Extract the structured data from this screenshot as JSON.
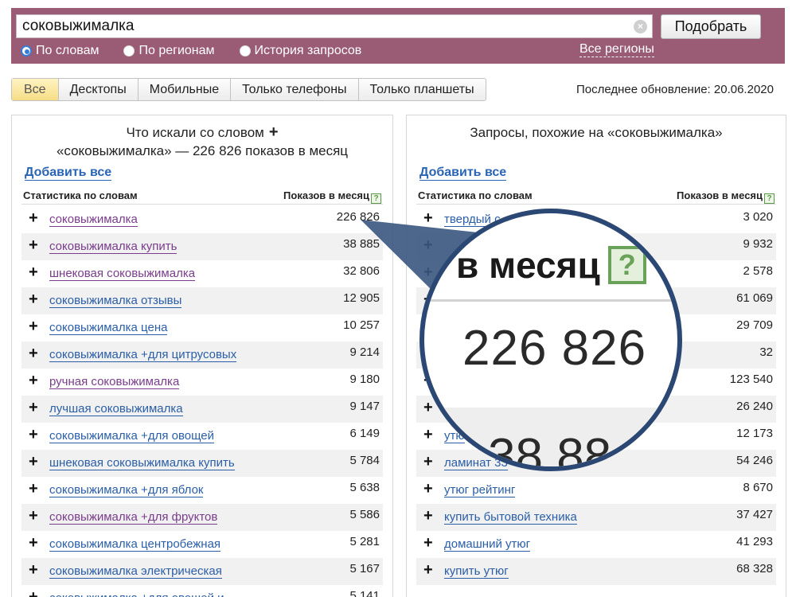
{
  "search": {
    "query": "соковыжималка",
    "clear_label": "×",
    "submit_label": "Подобрать",
    "modes": [
      "По словам",
      "По регионам",
      "История запросов"
    ],
    "selected_mode": "По словам",
    "regions_label": "Все регионы"
  },
  "tabs": [
    "Все",
    "Десктопы",
    "Мобильные",
    "Только телефоны",
    "Только планшеты"
  ],
  "active_tab": "Все",
  "last_update": "Последнее обновление: 20.06.2020",
  "left_panel": {
    "title_line1": "Что искали со словом",
    "title_plus": "+",
    "title_line2": "«соковыжималка» — 226 826 показов в месяц",
    "add_all": "Добавить все",
    "col_phrase": "Статистика по словам",
    "col_count": "Показов в месяц",
    "help_icon": "?",
    "rows": [
      {
        "phrase": "соковыжималка",
        "count": "226 826",
        "visited": true
      },
      {
        "phrase": "соковыжималка купить",
        "count": "38 885",
        "visited": true
      },
      {
        "phrase": "шнековая соковыжималка",
        "count": "32 806",
        "visited": true
      },
      {
        "phrase": "соковыжималка отзывы",
        "count": "12 905",
        "visited": false
      },
      {
        "phrase": "соковыжималка цена",
        "count": "10 257",
        "visited": false
      },
      {
        "phrase": "соковыжималка +для цитрусовых",
        "count": "9 214",
        "visited": false
      },
      {
        "phrase": "ручная соковыжималка",
        "count": "9 180",
        "visited": true
      },
      {
        "phrase": "лучшая соковыжималка",
        "count": "9 147",
        "visited": false
      },
      {
        "phrase": "соковыжималка +для овощей",
        "count": "6 149",
        "visited": false
      },
      {
        "phrase": "шнековая соковыжималка купить",
        "count": "5 784",
        "visited": false
      },
      {
        "phrase": "соковыжималка +для яблок",
        "count": "5 638",
        "visited": false
      },
      {
        "phrase": "соковыжималка +для фруктов",
        "count": "5 586",
        "visited": true
      },
      {
        "phrase": "соковыжималка центробежная",
        "count": "5 281",
        "visited": false
      },
      {
        "phrase": "соковыжималка электрическая",
        "count": "5 167",
        "visited": false
      },
      {
        "phrase": "соковыжималка +для овощей и",
        "count": "5 141",
        "visited": false
      }
    ]
  },
  "right_panel": {
    "title": "Запросы, похожие на «соковыжималка»",
    "add_all": "Добавить все",
    "col_phrase": "Статистика по словам",
    "col_count": "Показов в месяц",
    "help_icon": "?",
    "rows": [
      {
        "phrase": "твердый с",
        "count": "3 020"
      },
      {
        "phrase": "",
        "count": "9 932"
      },
      {
        "phrase": "",
        "count": "2 578"
      },
      {
        "phrase": "",
        "count": "61 069"
      },
      {
        "phrase": "",
        "count": "29 709"
      },
      {
        "phrase": "",
        "count": "32"
      },
      {
        "phrase": "",
        "count": "123 540"
      },
      {
        "phrase": "",
        "count": "26 240"
      },
      {
        "phrase": "утю",
        "count": "12 173"
      },
      {
        "phrase": "ламинат 33",
        "count": "54 246"
      },
      {
        "phrase": "утюг рейтинг",
        "count": "8 670"
      },
      {
        "phrase": "купить бытовой техника",
        "count": "37 427"
      },
      {
        "phrase": "домашний утюг",
        "count": "41 293"
      },
      {
        "phrase": "купить утюг",
        "count": "68 328"
      }
    ]
  },
  "magnifier": {
    "header_word": "месяц",
    "header_prefix": "в",
    "help_icon": "?",
    "value": "226 826",
    "next_value": "38 88"
  },
  "colors": {
    "band": "#9a5c74",
    "link": "#2a5ea8",
    "visited_link": "#7a3c8c",
    "active_tab": "#f6dd86",
    "magnifier_ring": "#2b4773"
  }
}
